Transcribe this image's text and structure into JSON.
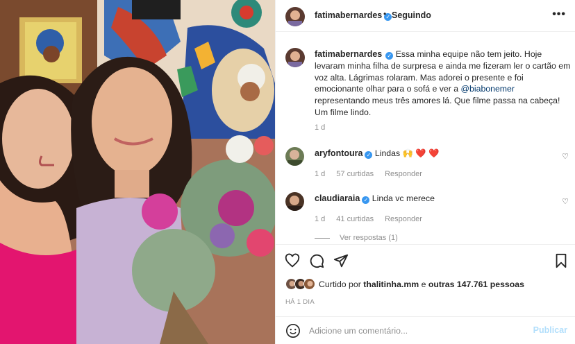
{
  "post_image": {
    "kind": "photo",
    "subject": "selfie-with-flowers"
  },
  "header": {
    "username": "fatimabernardes",
    "separator": "•",
    "follow_status": "Seguindo",
    "more_icon": "more-horizontal-icon"
  },
  "caption": {
    "username": "fatimabernardes",
    "text_before": "Essa minha equipe não tem jeito. Hoje levaram minha filha de surpresa e ainda me fizeram ler o cartão em voz alta. Lágrimas rolaram. Mas adorei o presente e foi emocionante olhar para o sofá e ver a ",
    "mention": "@biabonemer",
    "text_after": " representando meus três amores lá. Que filme passa na cabeça! Um filme lindo.",
    "time": "1 d"
  },
  "comments": [
    {
      "username": "aryfontoura",
      "text": "Lindas 🙌 ❤️ ❤️",
      "time": "1 d",
      "likes": "57 curtidas",
      "reply_label": "Responder"
    },
    {
      "username": "claudiaraia",
      "text": "Linda vc merece",
      "time": "1 d",
      "likes": "41 curtidas",
      "reply_label": "Responder",
      "view_replies": "Ver respostas (1)"
    }
  ],
  "likes_summary": {
    "prefix": "Curtido por ",
    "user": "thalitinha.mm",
    "middle": " e ",
    "others": "outras 147.761 pessoas"
  },
  "posted_ago": "HÁ 1 DIA",
  "comment_box": {
    "placeholder": "Adicione um comentário...",
    "publish_label": "Publicar"
  },
  "colors": {
    "verified": "#3897f0",
    "mention": "#00376b",
    "publish_disabled": "#b2dffc",
    "heart": "#ed4956",
    "secondary_text": "#8e8e8e"
  }
}
